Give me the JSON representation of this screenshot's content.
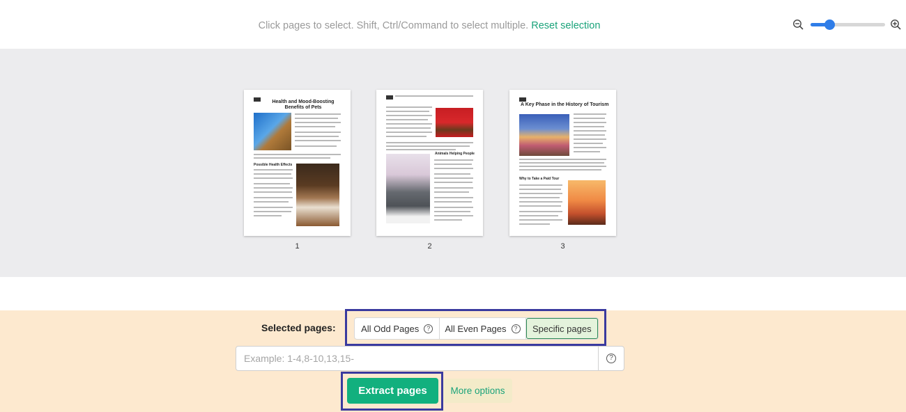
{
  "instructions": {
    "text": "Click pages to select. Shift, Ctrl/Command to select multiple.",
    "reset_label": "Reset selection"
  },
  "zoom": {
    "level_fraction": 0.25
  },
  "pages": [
    {
      "number": "1",
      "heading": "Health and Mood-Boosting Benefits of Pets",
      "subheading": "Possible Health Effects"
    },
    {
      "number": "2",
      "heading": "",
      "subheading": "Animals Helping People"
    },
    {
      "number": "3",
      "heading": "A Key Phase in the History of Tourism",
      "subheading": "Why to Take a Paid Tour"
    }
  ],
  "selection": {
    "label": "Selected pages:",
    "options": [
      {
        "label": "All Odd Pages",
        "help": "?"
      },
      {
        "label": "All Even Pages",
        "help": "?"
      },
      {
        "label": "Specific pages"
      }
    ],
    "active_option": "Specific pages",
    "input_placeholder": "Example: 1-4,8-10,13,15-",
    "input_value": "",
    "input_help": "?"
  },
  "actions": {
    "extract_label": "Extract pages",
    "more_label": "More options"
  },
  "colors": {
    "accent": "#12b07e",
    "link": "#1aa37a",
    "highlight_box": "#3a3a9f",
    "panel_bg": "#fde9cf",
    "page_area_bg": "#ececee"
  }
}
